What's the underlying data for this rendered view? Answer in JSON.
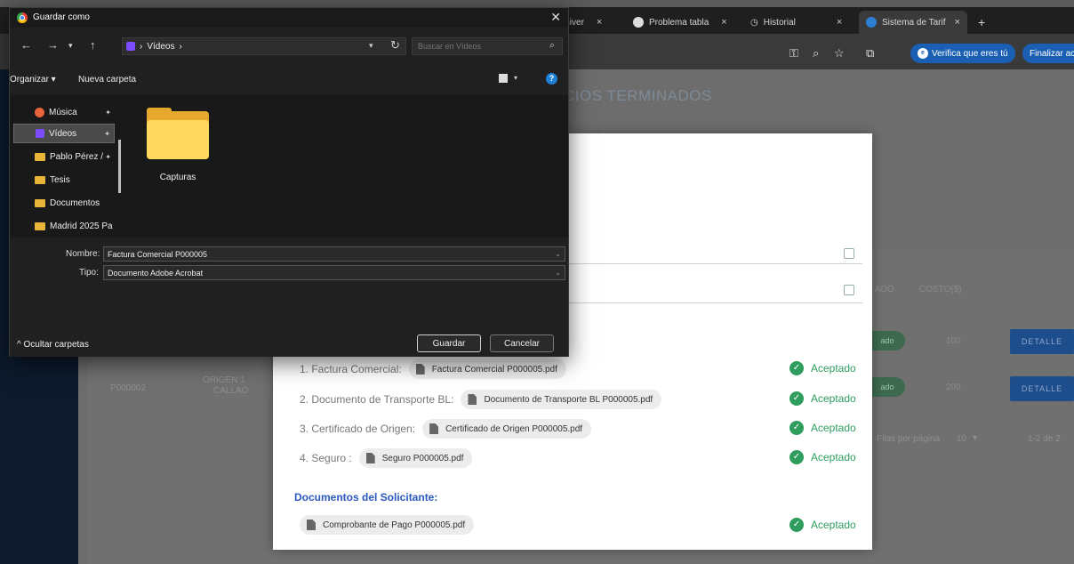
{
  "browser": {
    "tabs": [
      {
        "label": "Univer",
        "close": "×"
      },
      {
        "label": "Problema tabla",
        "close": "×"
      },
      {
        "label": "Historial",
        "close": "×"
      },
      {
        "label": "Sistema de Tarif",
        "close": "×"
      }
    ],
    "new_tab": "+",
    "verify_label": "Verifica que eres tú",
    "finish_label": "Finalizar ac"
  },
  "page": {
    "heading": "CIOS TERMINADOS",
    "table_headers": {
      "state": "ADO",
      "cost": "COSTO($)"
    },
    "rows": [
      {
        "state": "ado",
        "cost": "100",
        "action": "DETALLE"
      },
      {
        "code": "P000002",
        "origin": "ORIGEN 1",
        "port": "CALLAO",
        "state": "ado",
        "cost": "200",
        "action": "DETALLE"
      }
    ],
    "pagination": {
      "rows_per_page_label": "Filas por página",
      "rows_per_page": "10",
      "range": "1-2 de 2"
    }
  },
  "modal": {
    "documents": [
      {
        "label": "1. Factura Comercial:",
        "file": "Factura Comercial P000005.pdf",
        "status": "Aceptado"
      },
      {
        "label": "2. Documento de Transporte BL:",
        "file": "Documento de Transporte BL P000005.pdf",
        "status": "Aceptado"
      },
      {
        "label": "3. Certificado de Origen:",
        "file": "Certificado de Origen P000005.pdf",
        "status": "Aceptado"
      },
      {
        "label": "4. Seguro :",
        "file": "Seguro P000005.pdf",
        "status": "Aceptado"
      }
    ],
    "applicant_heading": "Documentos del Solicitante:",
    "applicant_docs": [
      {
        "file": "Comprobante de Pago P000005.pdf",
        "status": "Aceptado"
      }
    ]
  },
  "dialog": {
    "title": "Guardar como",
    "path": "Vídeos",
    "search_placeholder": "Buscar en Vídeos",
    "organize": "Organizar ▾",
    "new_folder": "Nueva carpeta",
    "nav_items": [
      {
        "label": "Música",
        "icon": "music-icon"
      },
      {
        "label": "Vídeos",
        "icon": "videos-icon"
      },
      {
        "label": "Pablo Pérez /",
        "icon": "folder-icon"
      },
      {
        "label": "Tesis",
        "icon": "folder-icon"
      },
      {
        "label": "Documentos",
        "icon": "folder-icon"
      },
      {
        "label": "Madrid 2025 Pa",
        "icon": "folder-icon"
      }
    ],
    "files": [
      {
        "name": "Capturas",
        "icon": "folder-icon"
      }
    ],
    "filename_label": "Nombre:",
    "filename_value": "Factura Comercial P000005",
    "type_label": "Tipo:",
    "type_value": "Documento Adobe Acrobat",
    "hide_folders": "Ocultar carpetas",
    "save": "Guardar",
    "cancel": "Cancelar"
  }
}
